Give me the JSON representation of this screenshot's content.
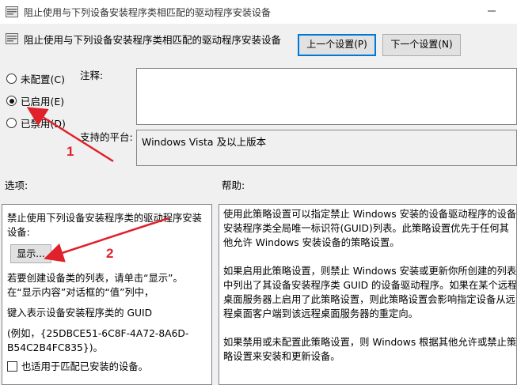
{
  "window": {
    "title": "阻止使用与下列设备安装程序类相匹配的驱动程序安装设备"
  },
  "header": {
    "policy_name": "阻止使用与下列设备安装程序类相匹配的驱动程序安装设备",
    "prev_button": "上一个设置(P)",
    "next_button": "下一个设置(N)"
  },
  "state_options": [
    {
      "label": "未配置(C)",
      "checked": false
    },
    {
      "label": "已启用(E)",
      "checked": true
    },
    {
      "label": "已禁用(D)",
      "checked": false
    }
  ],
  "comment": {
    "label": "注释:",
    "value": ""
  },
  "platform": {
    "label": "支持的平台:",
    "value": "Windows Vista 及以上版本"
  },
  "options_section": {
    "label": "选项:",
    "title": "禁止使用下列设备安装程序类的驱动程序安装设备:",
    "show_button": "显示...",
    "hint": "若要创建设备类的列表，请单击“显示”。在“显示内容”对话框的“值”列中，",
    "guid_line": "键入表示设备安装程序类的 GUID",
    "example": "(例如，{25DBCE51-6C8F-4A72-8A6D-B54C2B4FC835})。",
    "checkbox_label": "也适用于匹配已安装的设备。",
    "checkbox_checked": false
  },
  "help_section": {
    "label": "帮助:",
    "paragraphs": [
      "使用此策略设置可以指定禁止 Windows 安装的设备驱动程序的设备安装程序类全局唯一标识符(GUID)列表。此策略设置优先于任何其他允许 Windows 安装设备的策略设置。",
      "如果启用此策略设置，则禁止 Windows 安装或更新你所创建的列表中列出了其设备安装程序类 GUID 的设备驱动程序。如果在某个远程桌面服务器上启用了此策略设置，则此策略设置会影响指定设备从远程桌面客户端到该远程桌面服务器的重定向。",
      "如果禁用或未配置此策略设置，则 Windows 根据其他允许或禁止策略设置来安装和更新设备。"
    ]
  },
  "annotations": [
    {
      "number": "1",
      "color": "#e0202a"
    },
    {
      "number": "2",
      "color": "#e0202a"
    }
  ],
  "colors": {
    "accent": "#0078d7",
    "annotation": "#e0202a"
  }
}
